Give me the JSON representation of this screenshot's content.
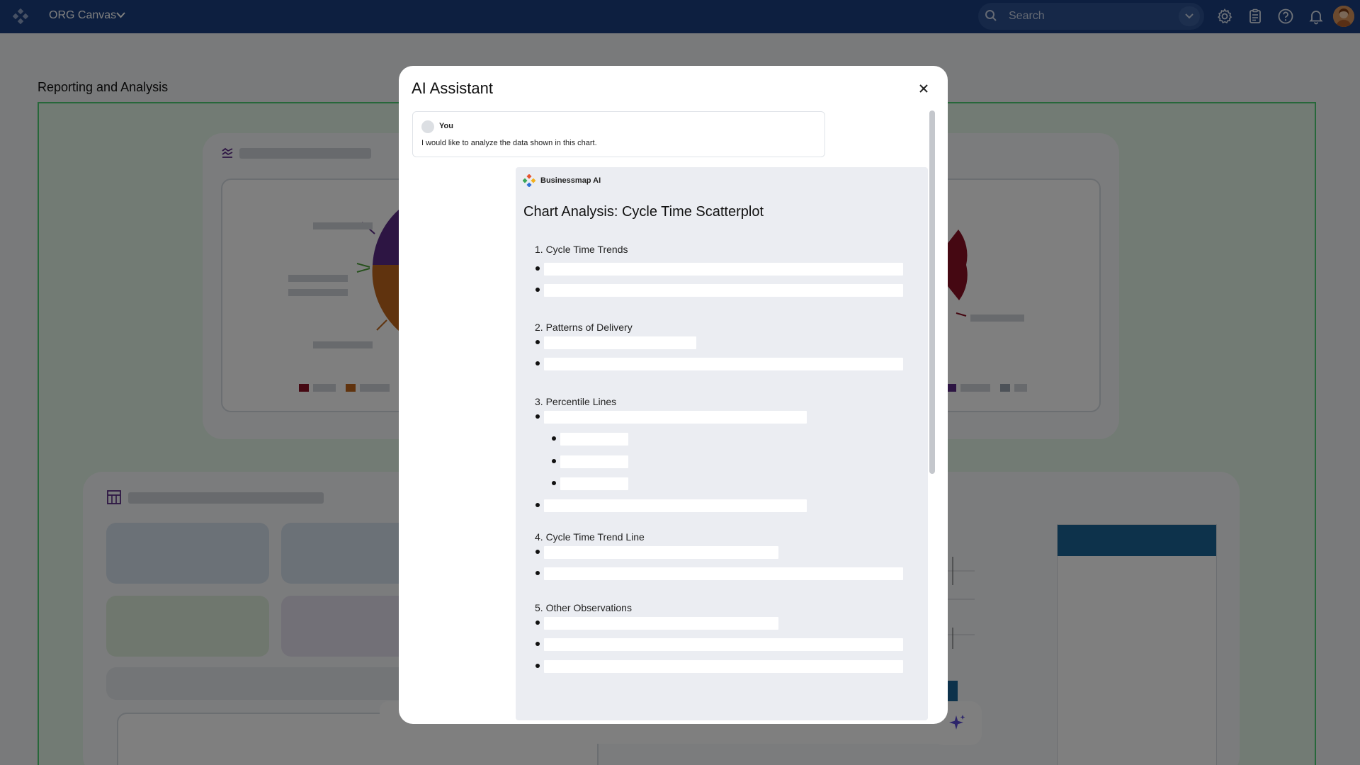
{
  "topbar": {
    "org_name": "ORG Canvas",
    "search_placeholder": "Search",
    "icons": [
      "settings-icon",
      "clipboard-icon",
      "help-icon",
      "bell-icon"
    ]
  },
  "page": {
    "title": "Reporting and Analysis"
  },
  "colors": {
    "topbar": "#1b3f80",
    "canvas_border": "#4fcf75",
    "chart_purple": "#5b2a86",
    "chart_orange": "#c0661c",
    "chart_red": "#8a1024",
    "chart_blue": "#1a6496",
    "overlay": "rgba(0,0,0,0.5)"
  },
  "modal": {
    "title": "AI Assistant",
    "user_message": {
      "author": "You",
      "text": "I would like to analyze the data shown in this chart."
    },
    "ai_message": {
      "author": "Businessmap AI",
      "heading": "Chart Analysis: Cycle Time Scatterplot",
      "sections": [
        {
          "title": "1. Cycle Time Trends"
        },
        {
          "title": "2. Patterns of Delivery"
        },
        {
          "title": "3. Percentile Lines"
        },
        {
          "title": "4. Cycle Time Trend Line"
        },
        {
          "title": "5. Other Observations"
        }
      ]
    }
  }
}
